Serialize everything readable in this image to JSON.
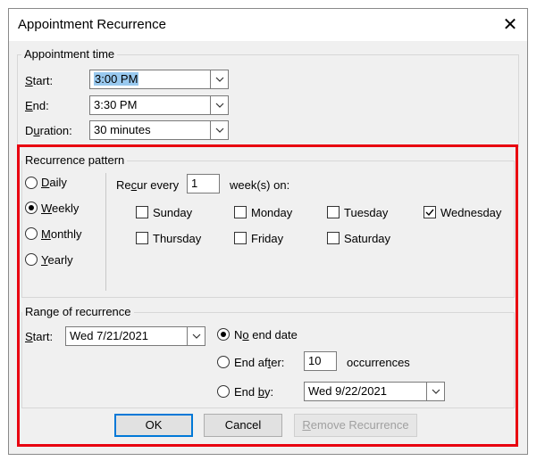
{
  "window": {
    "title": "Appointment Recurrence",
    "close_glyph": "✕"
  },
  "appointment_time": {
    "legend": "Appointment time",
    "start_label": {
      "pre": "",
      "key": "S",
      "post": "tart:"
    },
    "end_label": {
      "pre": "",
      "key": "E",
      "post": "nd:"
    },
    "duration_label": {
      "pre": "D",
      "key": "u",
      "post": "ration:"
    },
    "start_value": "3:00 PM",
    "end_value": "3:30 PM",
    "duration_value": "30 minutes"
  },
  "recurrence_pattern": {
    "legend": "Recurrence pattern",
    "types": [
      {
        "pre": "",
        "key": "D",
        "post": "aily",
        "selected": false
      },
      {
        "pre": "",
        "key": "W",
        "post": "eekly",
        "selected": true
      },
      {
        "pre": "",
        "key": "M",
        "post": "onthly",
        "selected": false
      },
      {
        "pre": "",
        "key": "Y",
        "post": "early",
        "selected": false
      }
    ],
    "recur_label": {
      "pre": "Re",
      "key": "c",
      "post": "ur every"
    },
    "recur_value": "1",
    "weeks_on_label": "week(s) on:",
    "days": [
      {
        "name": "Sunday",
        "checked": false
      },
      {
        "name": "Monday",
        "checked": false
      },
      {
        "name": "Tuesday",
        "checked": false
      },
      {
        "name": "Wednesday",
        "checked": true
      },
      {
        "name": "Thursday",
        "checked": false
      },
      {
        "name": "Friday",
        "checked": false
      },
      {
        "name": "Saturday",
        "checked": false
      }
    ]
  },
  "range": {
    "legend": "Range of recurrence",
    "start_label": {
      "pre": "",
      "key": "S",
      "post": "tart:"
    },
    "start_value": "Wed 7/21/2021",
    "no_end_label": {
      "pre": "N",
      "key": "o",
      "post": " end date"
    },
    "end_after_label": {
      "pre": "End af",
      "key": "t",
      "post": "er:"
    },
    "occurrences_value": "10",
    "occurrences_label": "occurrences",
    "end_by_label": {
      "pre": "End ",
      "key": "b",
      "post": "y:"
    },
    "end_by_value": "Wed 9/22/2021",
    "selected": "no_end"
  },
  "buttons": {
    "ok": "OK",
    "cancel": "Cancel",
    "remove": {
      "pre": "",
      "key": "R",
      "post": "emove Recurrence"
    }
  },
  "colors": {
    "highlight_box": "#e8000f",
    "default_button_border": "#0078d7",
    "selection": "#99c9ef"
  }
}
